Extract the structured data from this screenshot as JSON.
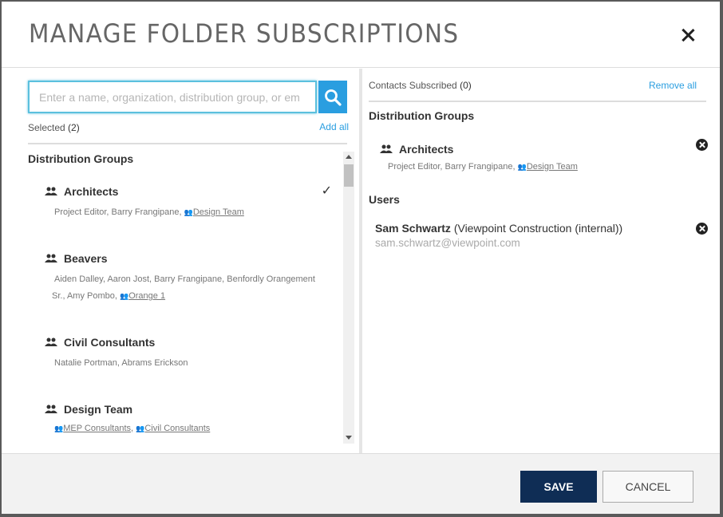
{
  "modal": {
    "title": "MANAGE FOLDER SUBSCRIPTIONS"
  },
  "left": {
    "search_placeholder": "Enter a name, organization, distribution group, or em",
    "selected_label": "Selected",
    "selected_count": "(2)",
    "add_all_label": "Add all",
    "groups_heading": "Distribution Groups",
    "groups": [
      {
        "name": "Architects",
        "members_text": "Project Editor, Barry Frangipane, ",
        "sub_groups": [
          "Design Team"
        ],
        "selected": true
      },
      {
        "name": "Beavers",
        "members_text": "Aiden Dalley, Aaron Jost, Barry Frangipane, Benfordly Orangement",
        "members_text_2": "Sr., Amy Pombo, ",
        "sub_groups": [
          "Orange 1"
        ],
        "selected": false
      },
      {
        "name": "Civil Consultants",
        "members_text": "Natalie Portman, Abrams Erickson",
        "sub_groups": [],
        "selected": false
      },
      {
        "name": "Design Team",
        "members_text": "",
        "sub_groups": [
          "MEP Consultants",
          "Civil Consultants"
        ],
        "selected": false
      }
    ]
  },
  "right": {
    "contacts_label": "Contacts Subscribed",
    "contacts_count": "(0)",
    "remove_all_label": "Remove all",
    "groups_heading": "Distribution Groups",
    "groups": [
      {
        "name": "Architects",
        "members_text": "Project Editor, Barry Frangipane, ",
        "sub_groups": [
          "Design Team"
        ]
      }
    ],
    "users_heading": "Users",
    "users": [
      {
        "name": "Sam Schwartz",
        "org": "(Viewpoint Construction (internal))",
        "email": "sam.schwartz@viewpoint.com"
      }
    ]
  },
  "footer": {
    "save_label": "SAVE",
    "cancel_label": "CANCEL"
  },
  "colors": {
    "accent": "#2a9ee0",
    "primary_button": "#0f2d55",
    "focus_ring": "#5bc0de"
  }
}
